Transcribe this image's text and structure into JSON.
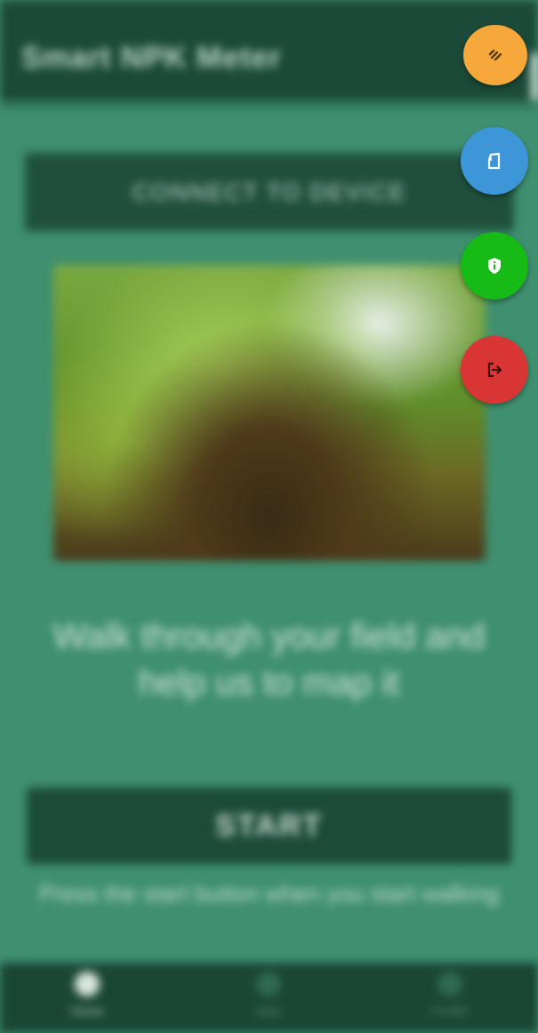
{
  "app": {
    "title": "Smart NPK Meter",
    "connect_label": "CONNECT TO DEVICE",
    "tagline": "Walk through your field and help us to map it",
    "start_label": "START",
    "hint": "Press the start button when you start walking"
  },
  "bottom_nav": {
    "items": [
      {
        "label": "Home",
        "icon": "home-icon",
        "active": true
      },
      {
        "label": "Map",
        "icon": "map-icon",
        "active": false
      },
      {
        "label": "Profile",
        "icon": "profile-icon",
        "active": false
      }
    ]
  },
  "speed_dial": [
    {
      "name": "menu",
      "icon": "list-icon",
      "color": "#f6a83b"
    },
    {
      "name": "document",
      "icon": "document-icon",
      "color": "#3d96d8"
    },
    {
      "name": "privacy",
      "icon": "shield-info-icon",
      "color": "#16bb16"
    },
    {
      "name": "logout",
      "icon": "logout-icon",
      "color": "#da3535"
    }
  ],
  "colors": {
    "primary_dark": "#1b4a38",
    "background": "#3f9070"
  }
}
